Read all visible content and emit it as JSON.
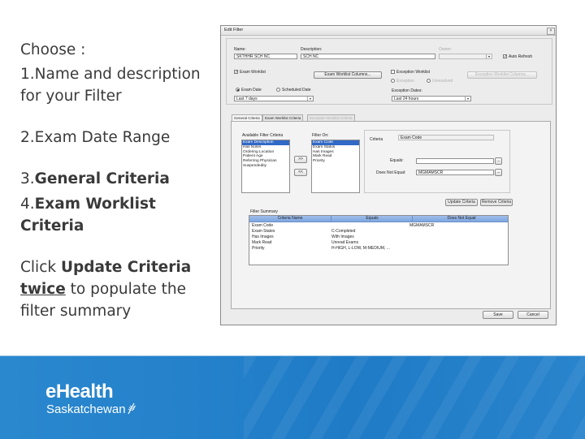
{
  "slide": {
    "choose": "Choose :",
    "item1_num": "1.",
    "item1_text": "Name and description for your Filter",
    "item2": "2.Exam Date Range",
    "item3_num": "3.",
    "item3_bold": "General Criteria",
    "item4_num": "4.",
    "item4_bold": "Exam Worklist Criteria",
    "click_pre": "Click ",
    "click_bold": "Update Criteria",
    "twice": "twice",
    "click_post": " to populate the filter summary"
  },
  "footer": {
    "logo_main": "eHealth",
    "logo_sub": "Saskatchewan"
  },
  "dialog": {
    "title": "Edit Filter",
    "name_label": "Name:",
    "name_value": "SKTHHR SCH NC",
    "description_label": "Description:",
    "description_value": "SCH NC",
    "owner_label": "Owner:",
    "auto_refresh_label": "Auto Refresh",
    "exam_worklist_label": "Exam Worklist",
    "exam_worklist_columns_button": "Exam Worklist Columns...",
    "exception_worklist_label": "Exception Worklist",
    "exception_worklist_columns_button": "Exception Worklist Columns...",
    "exam_date_label": "Exam Date",
    "scheduled_date_label": "Scheduled Date",
    "exception_sub1": "Exception",
    "exception_sub2": "Unresolved",
    "exam_range_value": "Last 7 days",
    "exception_dates_label": "Exception Dates:",
    "exception_range_value": "Last 24 hours",
    "tabs": [
      "General Criteria",
      "Exam Worklist Criteria",
      "Exception Worklist Criteria"
    ],
    "available_label": "Available Filter Criteria",
    "available_items": [
      "Exam Description",
      "Has Notes",
      "Ordering Location",
      "Patient Age",
      "Referring Physician",
      "Suspendedity"
    ],
    "filter_on_label": "Filter On:",
    "filter_on_items": [
      "Exam Code",
      "Exam Status",
      "Has Images",
      "Mark Read",
      "Priority"
    ],
    "add_button": ">>",
    "remove_button": "<<",
    "criteria_label": "Criteria",
    "criteria_value": "Exam Code",
    "equals_label": "Equals:",
    "equals_value": "",
    "not_equal_label": "Does Not Equal:",
    "not_equal_value": "MGMAMSCR",
    "browse_button": "...",
    "update_criteria_button": "Update Criteria",
    "remove_criteria_button": "Remove Criteria",
    "filter_summary_label": "Filter Summary",
    "summary_headers": [
      "Criteria Name",
      "Equals",
      "Does Not Equal"
    ],
    "summary_rows": [
      {
        "name": "Exam Code",
        "equals": "",
        "not_equal": "MGMAMSCR"
      },
      {
        "name": "Exam States",
        "equals": "C-Completed",
        "not_equal": ""
      },
      {
        "name": "Has Images",
        "equals": "With Images",
        "not_equal": ""
      },
      {
        "name": "Mark Read",
        "equals": "Unread Exams",
        "not_equal": ""
      },
      {
        "name": "Priority",
        "equals": "H-HIGH, L-LOW, M-MEDIUM, ...",
        "not_equal": ""
      }
    ],
    "save_button": "Save",
    "cancel_button": "Cancel"
  }
}
